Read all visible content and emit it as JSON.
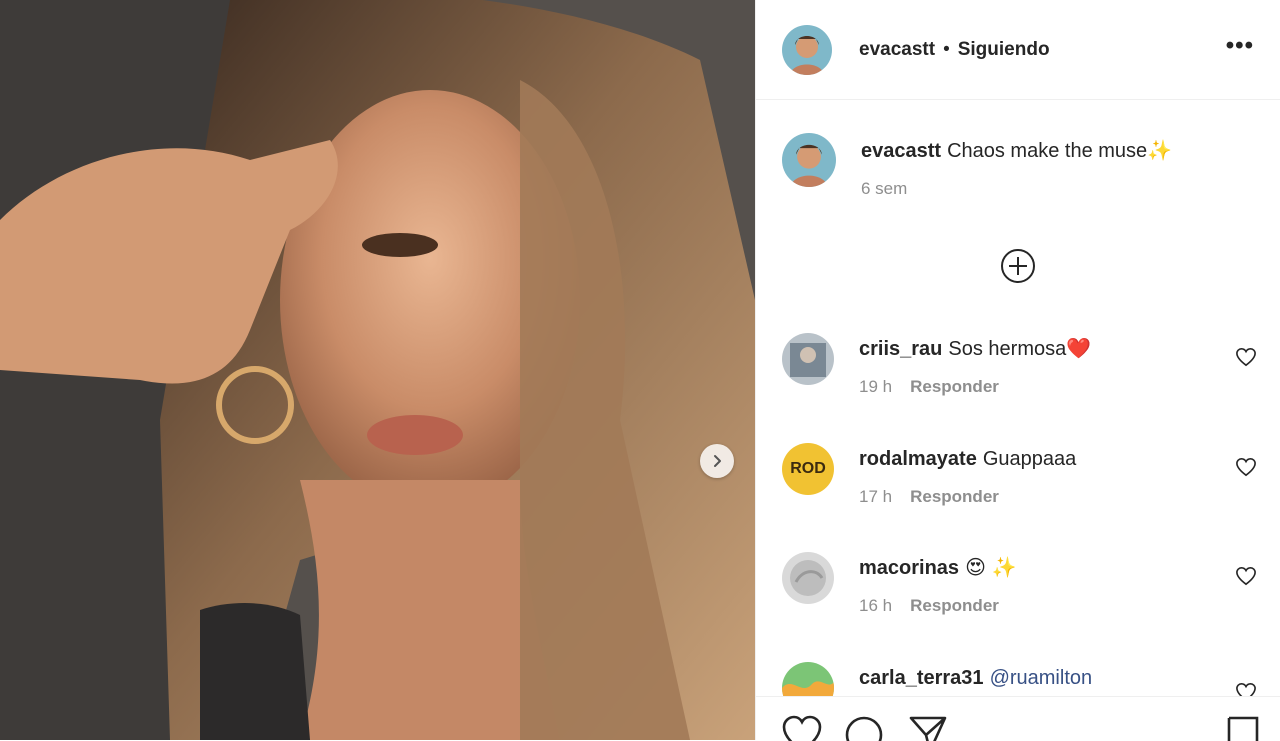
{
  "post": {
    "username": "evacastt",
    "separator": "•",
    "follow_status": "Siguiendo",
    "more_label": "•••"
  },
  "caption": {
    "username": "evacastt",
    "text": "Chaos make the muse",
    "emoji": "✨",
    "time": "6 sem"
  },
  "comments": [
    {
      "username": "criis_rau",
      "text": "Sos hermosa",
      "emoji": "❤️",
      "time": "19 h",
      "reply_label": "Responder"
    },
    {
      "username": "rodalmayate",
      "text": "Guappaaa",
      "emoji": "",
      "avatar_text": "ROD",
      "time": "17 h",
      "reply_label": "Responder"
    },
    {
      "username": "macorinas",
      "text": "",
      "emoji": "😍 ✨",
      "time": "16 h",
      "reply_label": "Responder"
    },
    {
      "username": "carla_terra31",
      "text": "@ruamilton",
      "emoji": "",
      "time": "",
      "reply_label": ""
    }
  ],
  "icons": [
    "more-icon",
    "add-circle-icon",
    "heart-icon",
    "comment-icon",
    "share-icon",
    "save-icon",
    "chevron-right-icon"
  ],
  "colors": {
    "mention": "#385185",
    "meta": "#8e8e8e",
    "text": "#262626",
    "rod_avatar": "#f1c232"
  }
}
